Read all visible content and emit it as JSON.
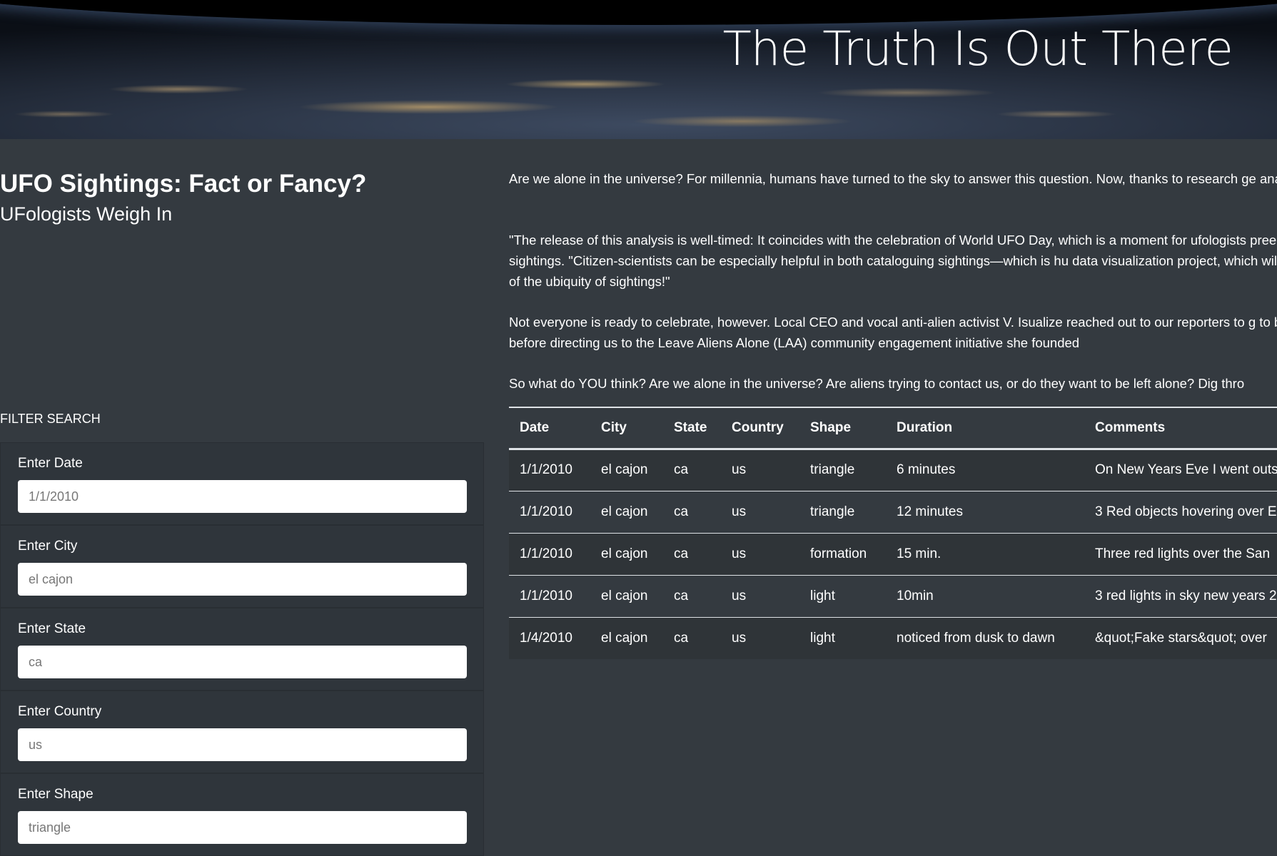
{
  "header": {
    "title": "The Truth Is Out There"
  },
  "sidebar": {
    "headline": "UFO Sightings: Fact or Fancy?",
    "subheadline": "UFologists Weigh In",
    "filter_title": "FILTER SEARCH",
    "filters": [
      {
        "label": "Enter Date",
        "placeholder": "1/1/2010"
      },
      {
        "label": "Enter City",
        "placeholder": "el cajon"
      },
      {
        "label": "Enter State",
        "placeholder": "ca"
      },
      {
        "label": "Enter Country",
        "placeholder": "us"
      },
      {
        "label": "Enter Shape",
        "placeholder": "triangle"
      }
    ]
  },
  "article": {
    "paragraphs": [
      "Are we alone in the universe? For millennia, humans have turned to the sky to answer this question. Now, thanks to research ge analysis.",
      "\"The release of this analysis is well-timed: It coincides with the celebration of World UFO Day, which is a moment for ufologists preeminent expert on circular sightings. \"Citizen-scientists can be especially helpful in both cataloguing sightings—which is hu data visualization project, which will help us raise awareness of the ubiquity of sightings!\"",
      "Not everyone is ready to celebrate, however. Local CEO and vocal anti-alien activist V. Isualize reached out to our reporters to g to be left alone,\" she stated, before directing us to the Leave Aliens Alone (LAA) community engagement initiative she founded",
      "So what do YOU think? Are we alone in the universe? Are aliens trying to contact us, or do they want to be left alone? Dig thro"
    ]
  },
  "table": {
    "columns": [
      "Date",
      "City",
      "State",
      "Country",
      "Shape",
      "Duration",
      "Comments"
    ],
    "rows": [
      [
        "1/1/2010",
        "el cajon",
        "ca",
        "us",
        "triangle",
        "6 minutes",
        "On New Years Eve I went outs"
      ],
      [
        "1/1/2010",
        "el cajon",
        "ca",
        "us",
        "triangle",
        "12 minutes",
        "3 Red objects hovering over E"
      ],
      [
        "1/1/2010",
        "el cajon",
        "ca",
        "us",
        "formation",
        "15 min.",
        "Three red lights over the San"
      ],
      [
        "1/1/2010",
        "el cajon",
        "ca",
        "us",
        "light",
        "10min",
        "3 red lights in sky new years 2"
      ],
      [
        "1/4/2010",
        "el cajon",
        "ca",
        "us",
        "light",
        "noticed from dusk to dawn",
        "&quot;Fake stars&quot; over"
      ]
    ]
  }
}
